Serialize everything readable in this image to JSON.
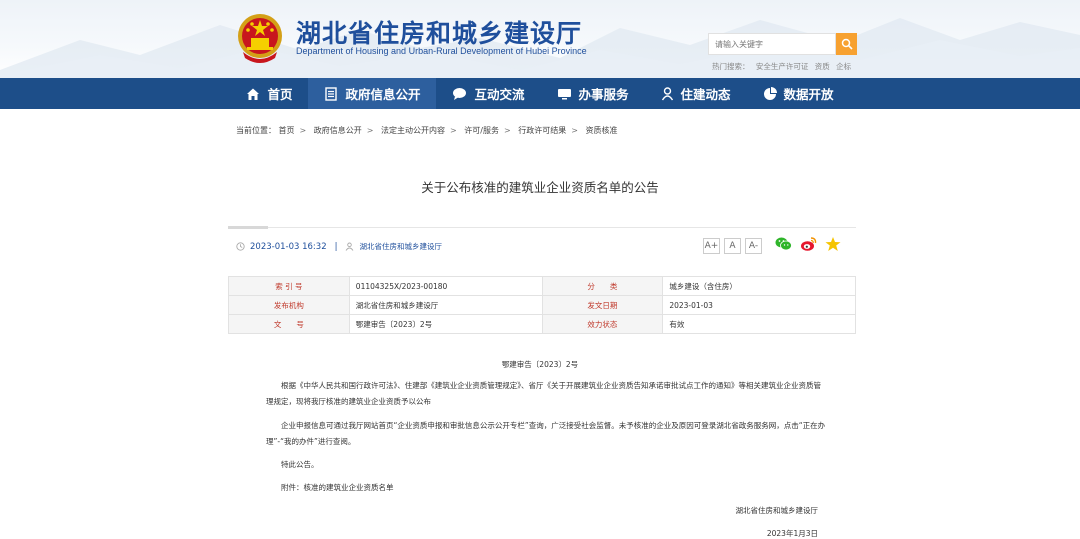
{
  "header": {
    "title": "湖北省住房和城乡建设厅",
    "subtitle": "Department of Housing and Urban-Rural Development of Hubei Province",
    "search_placeholder": "请输入关键字",
    "hot_label": "热门搜索：",
    "hot_items": [
      "安全生产许可证",
      "资质",
      "企标"
    ]
  },
  "nav": {
    "items": [
      {
        "label": "首页",
        "icon": "home-icon"
      },
      {
        "label": "政府信息公开",
        "icon": "document-icon"
      },
      {
        "label": "互动交流",
        "icon": "chat-icon"
      },
      {
        "label": "办事服务",
        "icon": "monitor-icon"
      },
      {
        "label": "住建动态",
        "icon": "person-icon"
      },
      {
        "label": "数据开放",
        "icon": "pie-chart-icon"
      }
    ],
    "active_index": 1
  },
  "breadcrumb": {
    "label": "当前位置：",
    "items": [
      "首页",
      "政府信息公开",
      "法定主动公开内容",
      "许可/服务",
      "行政许可结果",
      "资质核准"
    ]
  },
  "article": {
    "title": "关于公布核准的建筑业企业资质名单的公告",
    "datetime": "2023-01-03 16:32",
    "source": "湖北省住房和城乡建设厅",
    "font_buttons": [
      "A+",
      "A",
      "A-"
    ]
  },
  "info_table": {
    "rows": [
      [
        {
          "label": "索 引 号",
          "value": "01104325X/2023-00180"
        },
        {
          "label": "分　　类",
          "value": "城乡建设（含住房）"
        }
      ],
      [
        {
          "label": "发布机构",
          "value": "湖北省住房和城乡建设厅"
        },
        {
          "label": "发文日期",
          "value": "2023-01-03"
        }
      ],
      [
        {
          "label": "文　　号",
          "value": "鄂建审告〔2023〕2号"
        },
        {
          "label": "效力状态",
          "value": "有效"
        }
      ]
    ]
  },
  "body": {
    "doc_no": "鄂建审告〔2023〕2号",
    "p1": "根据《中华人民共和国行政许可法》、住建部《建筑业企业资质管理规定》、省厅《关于开展建筑业企业资质告知承诺审批试点工作的通知》等相关建筑业企业资质管理规定，现将我厅核准的建筑业企业资质予以公布",
    "p2": "企业申报信息可通过我厅网站首页“企业资质申报和审批信息公示公开专栏”查询，广泛接受社会监督。未予核准的企业及原因可登录湖北省政务服务网，点击“正在办理”-“我的办件”进行查阅。",
    "p3": "特此公告。",
    "p4": "附件：核准的建筑业企业资质名单",
    "sign_org": "湖北省住房和城乡建设厅",
    "sign_date": "2023年1月3日"
  },
  "colors": {
    "brand": "#1d4e89",
    "accent": "#f7a130",
    "label_red": "#c0392b"
  }
}
